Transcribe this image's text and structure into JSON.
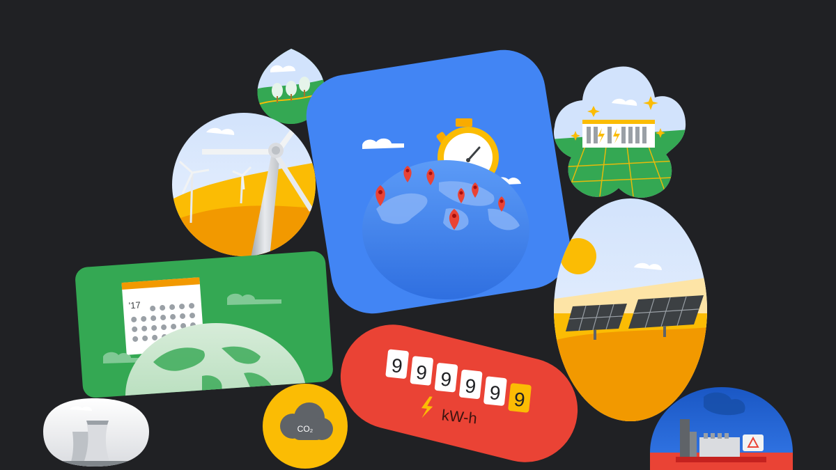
{
  "meter": {
    "digits": [
      "9",
      "9",
      "9",
      "9",
      "9",
      "9"
    ],
    "unit": "kW-h"
  },
  "calendar": {
    "year_label": "'17"
  },
  "co2_badge": {
    "label": "CO₂"
  },
  "colors": {
    "background": "#202124",
    "google_blue": "#4285F4",
    "google_red": "#EA4335",
    "google_yellow": "#FBBC04",
    "google_green": "#34A853",
    "pin_red": "#EA4335",
    "meter_last_digit": "#FBBC04"
  },
  "tiles": [
    {
      "name": "forest-drop-tile",
      "icon": "trees-icon"
    },
    {
      "name": "wind-turbine-tile",
      "icon": "wind-turbine-icon"
    },
    {
      "name": "globe-stopwatch-tile",
      "icon": "stopwatch-icon"
    },
    {
      "name": "data-center-tile",
      "icon": "server-rack-icon"
    },
    {
      "name": "solar-panels-tile",
      "icon": "solar-panel-icon"
    },
    {
      "name": "calendar-globe-tile",
      "icon": "calendar-icon"
    },
    {
      "name": "energy-meter-tile",
      "icon": "lightning-icon"
    },
    {
      "name": "co2-tile",
      "icon": "co2-cloud-icon"
    },
    {
      "name": "cooling-tower-tile",
      "icon": "cooling-tower-icon"
    },
    {
      "name": "power-plant-tile",
      "icon": "generator-icon"
    }
  ]
}
